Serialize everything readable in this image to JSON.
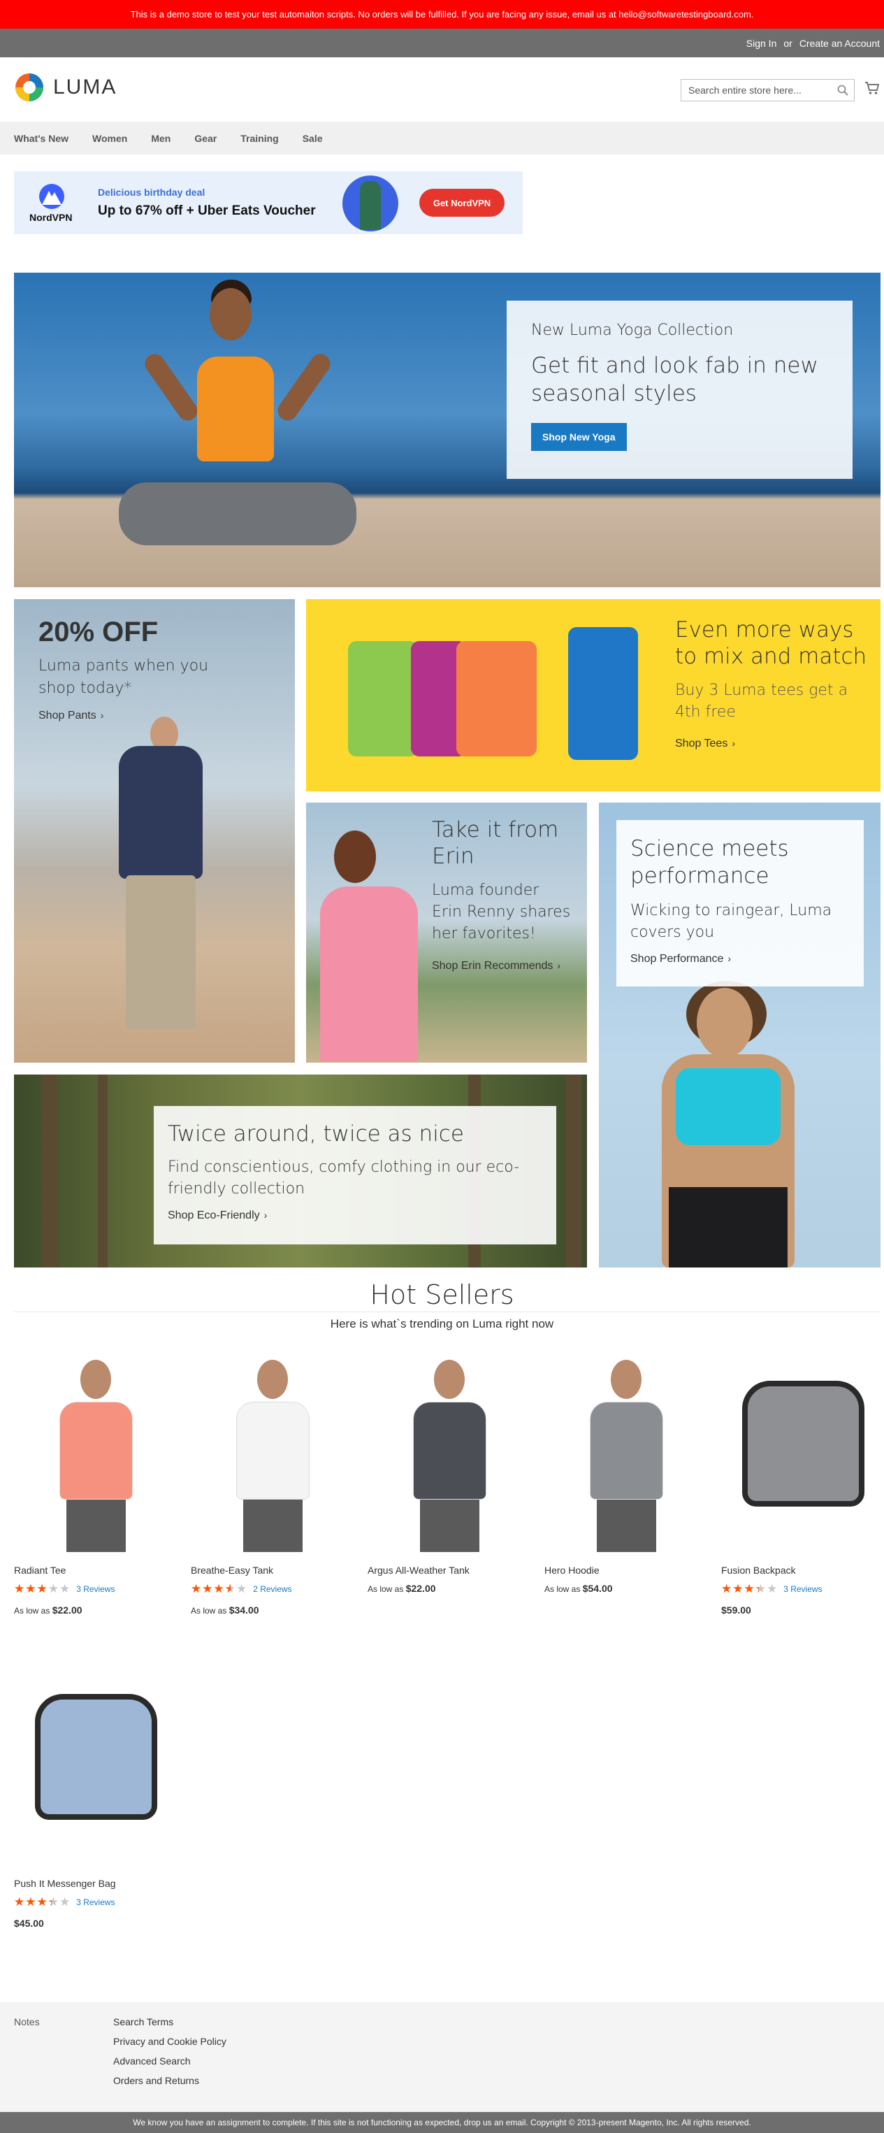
{
  "demo_notice": "This is a demo store to test your test automaiton scripts. No orders will be fulfilled. If you are facing any issue, email us at hello@softwaretestingboard.com.",
  "header": {
    "sign_in": "Sign In",
    "or": "or",
    "create_account": "Create an Account",
    "logo_text": "LUMA",
    "search_placeholder": "Search entire store here..."
  },
  "nav": [
    "What's New",
    "Women",
    "Men",
    "Gear",
    "Training",
    "Sale"
  ],
  "ad": {
    "brand": "NordVPN",
    "line1": "Delicious birthday deal",
    "line2": "Up to 67% off + Uber Eats Voucher",
    "cta": "Get NordVPN"
  },
  "hero": {
    "title": "New Luma Yoga Collection",
    "subtitle": "Get fit and look fab in new seasonal styles",
    "button": "Shop New Yoga"
  },
  "pants_block": {
    "headline": "20% OFF",
    "text": "Luma pants when you shop today*",
    "link": "Shop Pants"
  },
  "tees_block": {
    "headline": "Even more ways to mix and match",
    "text": "Buy 3 Luma tees get a 4th free",
    "link": "Shop Tees"
  },
  "erin_block": {
    "headline": "Take it from Erin",
    "text": "Luma founder Erin Renny shares her favorites!",
    "link": "Shop Erin Recommends"
  },
  "performance_block": {
    "headline": "Science meets performance",
    "text": "Wicking to raingear, Luma covers you",
    "link": "Shop Performance"
  },
  "eco_block": {
    "headline": "Twice around, twice as nice",
    "text": "Find conscientious, comfy clothing in our eco-friendly collection",
    "link": "Shop Eco-Friendly"
  },
  "hot_sellers": {
    "title": "Hot Sellers",
    "subtitle": "Here is what`s trending on Luma right now",
    "products": [
      {
        "name": "Radiant Tee",
        "rating": 0.6,
        "reviews": "3 Reviews",
        "price_prefix": "As low as",
        "price": "$22.00",
        "color": "#f7917f"
      },
      {
        "name": "Breathe-Easy Tank",
        "rating": 0.7,
        "reviews": "2 Reviews",
        "price_prefix": "As low as",
        "price": "$34.00",
        "color": "#f4f4f4"
      },
      {
        "name": "Argus All-Weather Tank",
        "rating": null,
        "reviews": "",
        "price_prefix": "As low as",
        "price": "$22.00",
        "color": "#4b4e55"
      },
      {
        "name": "Hero Hoodie",
        "rating": null,
        "reviews": "",
        "price_prefix": "As low as",
        "price": "$54.00",
        "color": "#8a8d91"
      },
      {
        "name": "Fusion Backpack",
        "rating": 0.67,
        "reviews": "3 Reviews",
        "price_prefix": "",
        "price": "$59.00",
        "color": "#8f9094"
      },
      {
        "name": "Push It Messenger Bag",
        "rating": 0.67,
        "reviews": "3 Reviews",
        "price_prefix": "",
        "price": "$45.00",
        "color": "#9fb7d6"
      }
    ]
  },
  "footer": {
    "notes": "Notes",
    "links": [
      "Search Terms",
      "Privacy and Cookie Policy",
      "Advanced Search",
      "Orders and Returns"
    ],
    "copyright": "We know you have an assignment to complete. If this site is not functioning as expected, drop us an email. Copyright © 2013-present Magento, Inc. All rights reserved."
  },
  "colors": {
    "demo_bar": "#ff0000",
    "header_panel": "#6e6e6e",
    "primary_button": "#1979c3",
    "star": "#ff5501",
    "tees_bg": "#fdd92e"
  }
}
